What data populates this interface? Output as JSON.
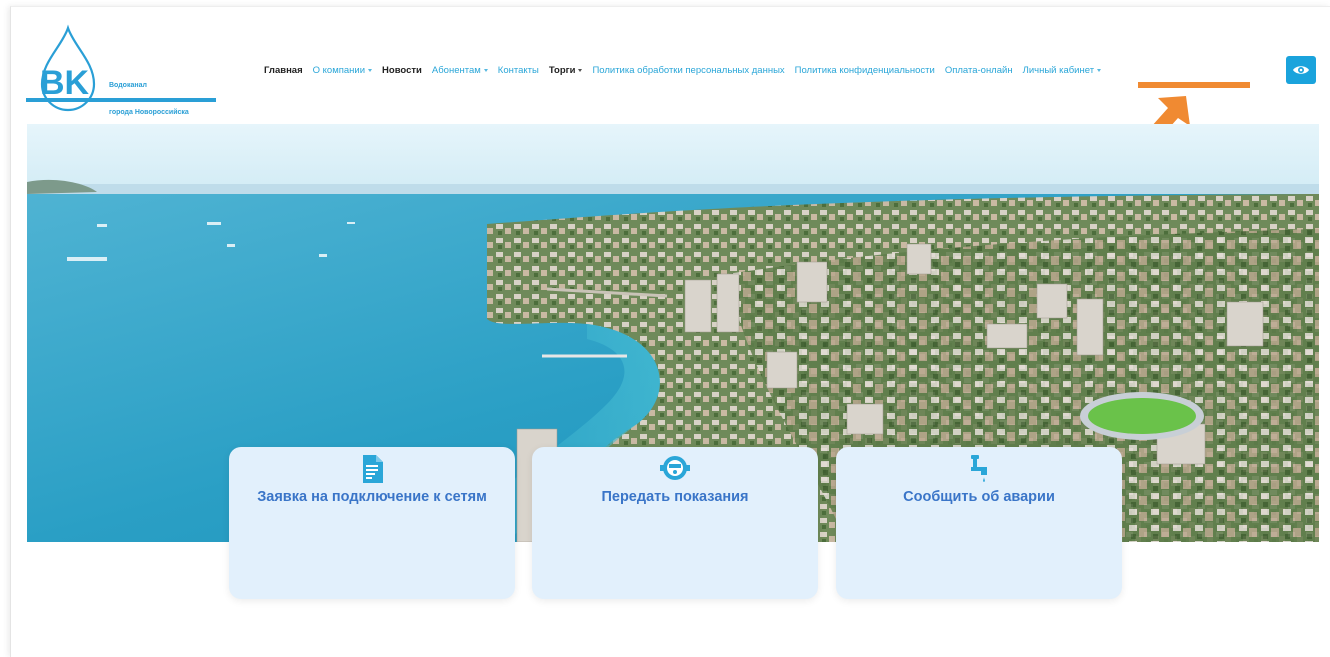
{
  "logo": {
    "letters": "BK",
    "line1": "Водоканал",
    "line2": "города Новороссийска",
    "color": "#2a9fd6"
  },
  "nav": {
    "items": [
      {
        "label": "Главная",
        "dropdown": false,
        "style": "dark"
      },
      {
        "label": "О компании",
        "dropdown": true,
        "style": "link"
      },
      {
        "label": "Новости",
        "dropdown": false,
        "style": "dark"
      },
      {
        "label": "Абонентам",
        "dropdown": true,
        "style": "link"
      },
      {
        "label": "Контакты",
        "dropdown": false,
        "style": "link"
      },
      {
        "label": "Торги",
        "dropdown": true,
        "style": "dark"
      },
      {
        "label": "Политика обработки персональных данных",
        "dropdown": false,
        "style": "link"
      },
      {
        "label": "Политика конфиденциальности",
        "dropdown": false,
        "style": "link"
      },
      {
        "label": "Оплата-онлайн",
        "dropdown": false,
        "style": "link"
      },
      {
        "label": "Личный кабинет",
        "dropdown": true,
        "style": "link"
      }
    ],
    "link_color": "#2aa6d8",
    "dark_color": "#222222"
  },
  "accessibility_button": {
    "icon": "eye-icon",
    "color": "#1aa3dc"
  },
  "annotation": {
    "color": "#f08a32",
    "icon": "arrow-icon"
  },
  "hero": {
    "description_icon": "city-sea-photo"
  },
  "cards": [
    {
      "title": "Заявка на подключение к сетям",
      "icon": "document-icon"
    },
    {
      "title": "Передать показания",
      "icon": "meter-icon"
    },
    {
      "title": "Сообщить об аварии",
      "icon": "faucet-icon"
    }
  ],
  "accent_color": "#1aa3dc",
  "card_title_color": "#3a75c8"
}
